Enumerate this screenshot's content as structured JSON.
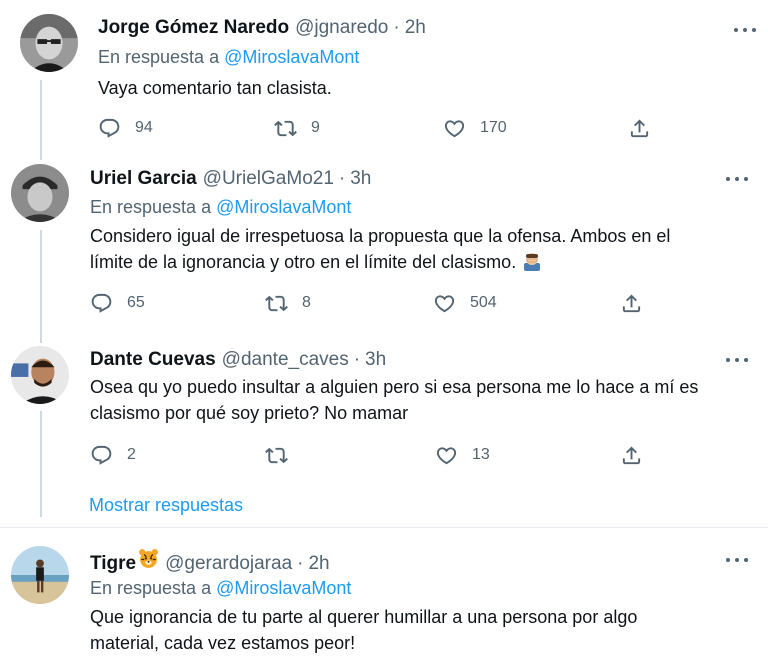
{
  "tweets": [
    {
      "name": "Jorge Gómez Naredo",
      "handle": "@jgnaredo",
      "time": "2h",
      "reply_prefix": "En respuesta a",
      "reply_mention": "@MiroslavaMont",
      "text": "Vaya comentario tan clasista.",
      "replies": "94",
      "retweets": "9",
      "likes": "170"
    },
    {
      "name": "Uriel Garcia",
      "handle": "@UrielGaMo21",
      "time": "3h",
      "reply_prefix": "En respuesta a",
      "reply_mention": "@MiroslavaMont",
      "text_line1": "Considero igual de irrespetuosa la propuesta que la ofensa. Ambos en el",
      "text_line2": "límite de la ignorancia y otro en el límite del clasismo.",
      "replies": "65",
      "retweets": "8",
      "likes": "504"
    },
    {
      "name": "Dante Cuevas",
      "handle": "@dante_caves",
      "time": "3h",
      "text_line1": "Osea qu yo puedo insultar a alguien pero si esa persona me lo hace a mí es",
      "text_line2": "clasismo por qué soy prieto? No mamar",
      "replies": "2",
      "retweets": "",
      "likes": "13"
    },
    {
      "name": "Tigre",
      "handle": "@gerardojaraa",
      "time": "2h",
      "reply_prefix": "En respuesta a",
      "reply_mention": "@MiroslavaMont",
      "text_line1": "Que ignorancia de tu parte al querer humillar a una persona por algo",
      "text_line2": "material, cada vez estamos peor!"
    }
  ],
  "show_replies_label": "Mostrar respuestas",
  "icons": {
    "reply": "reply-icon",
    "retweet": "retweet-icon",
    "like": "like-icon",
    "share": "share-icon",
    "more": "more-icon"
  },
  "colors": {
    "link": "#1d9bf0",
    "secondary_text": "#536471",
    "primary_text": "#0f1419",
    "thread_line": "#cfd9de"
  }
}
